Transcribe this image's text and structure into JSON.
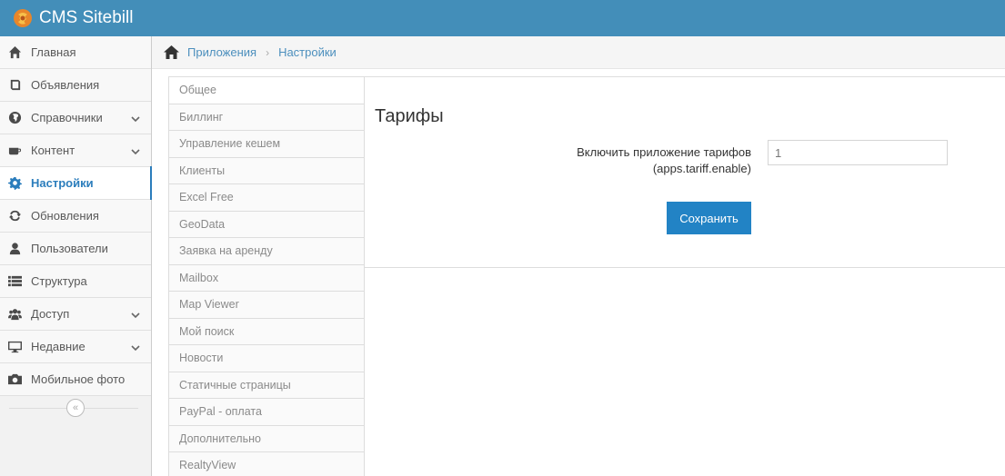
{
  "brand": {
    "name": "CMS Sitebill",
    "icon": "sitebill-logo-icon",
    "color": "#438eb9"
  },
  "sidebar": {
    "items": [
      {
        "label": "Главная",
        "icon": "home-icon",
        "has_submenu": false,
        "active": false
      },
      {
        "label": "Объявления",
        "icon": "book-icon",
        "has_submenu": false,
        "active": false
      },
      {
        "label": "Справочники",
        "icon": "globe-icon",
        "has_submenu": true,
        "active": false
      },
      {
        "label": "Контент",
        "icon": "coffee-icon",
        "has_submenu": true,
        "active": false
      },
      {
        "label": "Настройки",
        "icon": "cog-icon",
        "has_submenu": false,
        "active": true
      },
      {
        "label": "Обновления",
        "icon": "refresh-icon",
        "has_submenu": false,
        "active": false
      },
      {
        "label": "Пользователи",
        "icon": "user-icon",
        "has_submenu": false,
        "active": false
      },
      {
        "label": "Структура",
        "icon": "list-icon",
        "has_submenu": false,
        "active": false
      },
      {
        "label": "Доступ",
        "icon": "users-icon",
        "has_submenu": true,
        "active": false
      },
      {
        "label": "Недавние",
        "icon": "desktop-icon",
        "has_submenu": true,
        "active": false
      },
      {
        "label": "Мобильное фото",
        "icon": "camera-icon",
        "has_submenu": false,
        "active": false
      }
    ],
    "collapse_icon": "double-chevron-left-icon"
  },
  "breadcrumbs": {
    "items": [
      "Приложения",
      "Настройки"
    ],
    "separator": "›"
  },
  "settings_menu": {
    "items": [
      "Общее",
      "Биллинг",
      "Управление кешем",
      "Клиенты",
      "Excel Free",
      "GeoData",
      "Заявка на аренду",
      "Mailbox",
      "Map Viewer",
      "Мой поиск",
      "Новости",
      "Статичные страницы",
      "PayPal - оплата",
      "Дополнительно",
      "RealtyView"
    ]
  },
  "panel": {
    "title": "Тарифы",
    "field_label_line1": "Включить приложение тарифов",
    "field_label_line2": "(apps.tariff.enable)",
    "field_value": "1",
    "save_label": "Сохранить",
    "accent_color": "#2283c5"
  }
}
